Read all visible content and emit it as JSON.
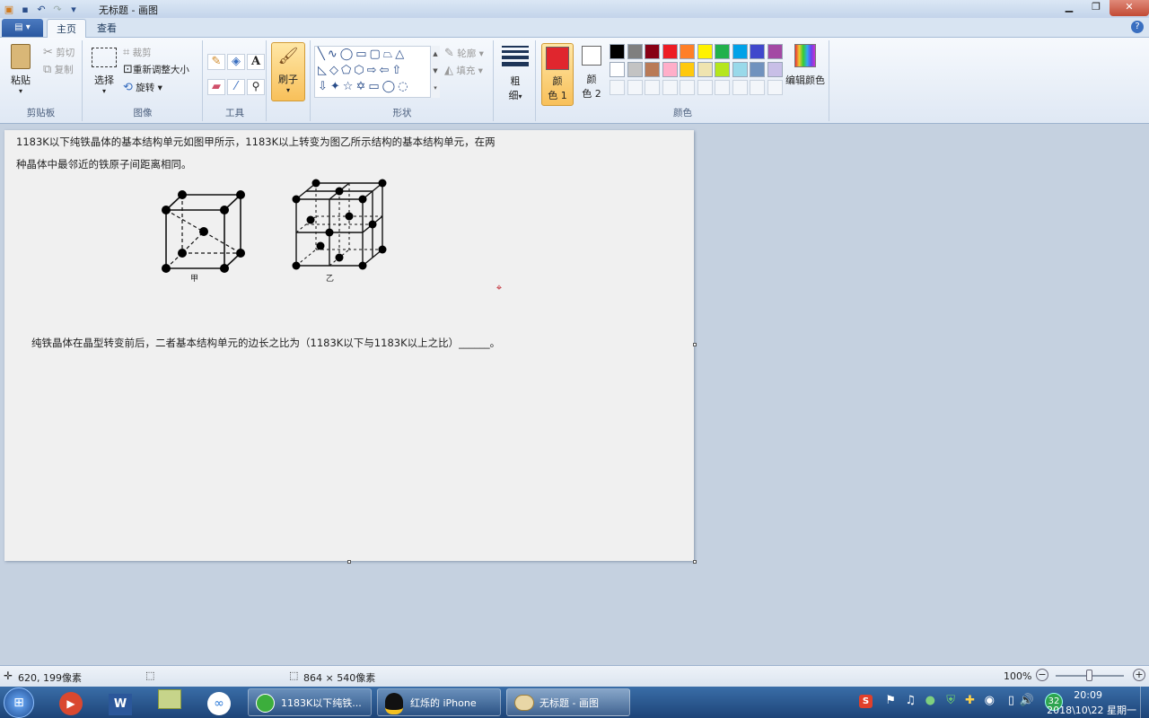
{
  "window": {
    "title": "无标题 - 画图"
  },
  "tabs": [
    {
      "label": "主页"
    },
    {
      "label": "查看"
    }
  ],
  "app_menu_label": "▤ ▾",
  "clipboard": {
    "paste": "粘贴",
    "cut": "剪切",
    "copy": "复制",
    "label": "剪贴板"
  },
  "image": {
    "select": "选择",
    "crop": "裁剪",
    "resize": "重新调整大小",
    "rotate": "旋转",
    "label": "图像"
  },
  "tools": {
    "label": "工具"
  },
  "brush": {
    "label": "刷子"
  },
  "shapes": {
    "outline": "轮廓",
    "fill": "填充",
    "label": "形状"
  },
  "size": {
    "label_line1": "粗",
    "label_line2": "细"
  },
  "colors": {
    "color1_line1": "颜",
    "color1_line2": "色 1",
    "color2_line1": "颜",
    "color2_line2": "色 2",
    "edit": "编辑颜色",
    "label": "颜色",
    "color1_value": "#e0262e",
    "color2_value": "#ffffff",
    "palette_row1": [
      "#000000",
      "#7f7f7f",
      "#880015",
      "#ed1c24",
      "#ff7f27",
      "#fff200",
      "#22b14c",
      "#00a2e8",
      "#3f48cc",
      "#a349a4"
    ],
    "palette_row2": [
      "#ffffff",
      "#c3c3c3",
      "#b97a57",
      "#ffaec9",
      "#ffc90e",
      "#efe4b0",
      "#b5e61d",
      "#99d9ea",
      "#7092be",
      "#c8bfe7"
    ]
  },
  "document": {
    "line1": "1183K以下纯铁晶体的基本结构单元如图甲所示，1183K以上转变为图乙所示结构的基本结构单元，在两",
    "line2": "种晶体中最邻近的铁原子间距离相同。",
    "fig1_label": "甲",
    "fig2_label": "乙",
    "question": "纯铁晶体在晶型转变前后，二者基本结构单元的边长之比为（1183K以下与1183K以上之比）______。"
  },
  "status": {
    "cursor_pos": "620, 199像素",
    "image_size": "864 × 540像素",
    "zoom": "100%"
  },
  "taskbar": {
    "task1": "1183K以下纯铁...",
    "task2": "红烁的 iPhone",
    "task3": "无标题 - 画图",
    "time": "20:09",
    "date": "2018\\10\\22 星期一",
    "badge": "32"
  }
}
